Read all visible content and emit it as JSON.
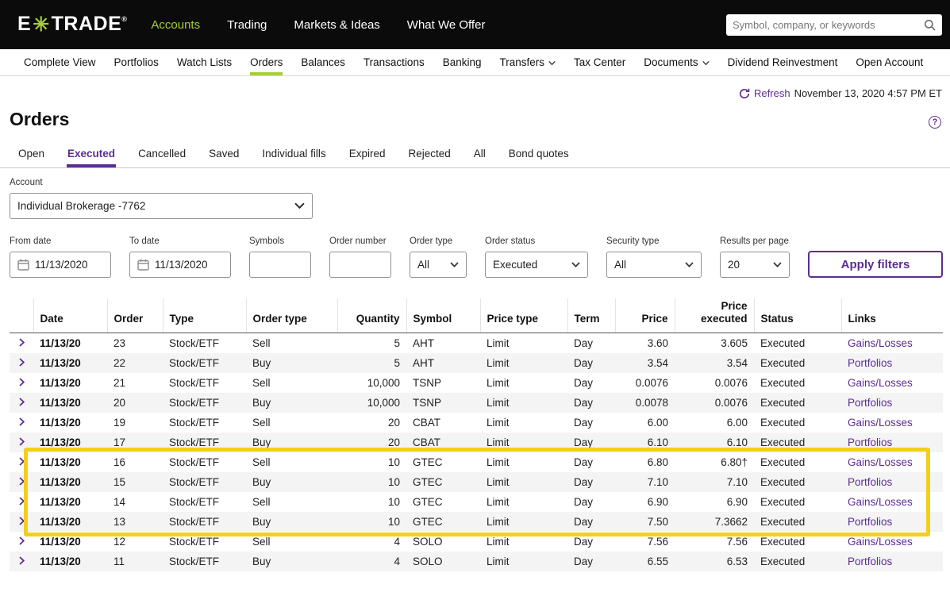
{
  "topnav": {
    "logo": {
      "prefix": "E",
      "star": "✳",
      "suffix": "TRADE",
      "reg": "®"
    },
    "items": [
      {
        "label": "Accounts",
        "active": true
      },
      {
        "label": "Trading",
        "active": false
      },
      {
        "label": "Markets & Ideas",
        "active": false
      },
      {
        "label": "What We Offer",
        "active": false
      }
    ],
    "search": {
      "placeholder": "Symbol, company, or keywords"
    }
  },
  "subnav": {
    "items": [
      {
        "label": "Complete View"
      },
      {
        "label": "Portfolios"
      },
      {
        "label": "Watch Lists"
      },
      {
        "label": "Orders",
        "active": true
      },
      {
        "label": "Balances"
      },
      {
        "label": "Transactions"
      },
      {
        "label": "Banking"
      },
      {
        "label": "Transfers",
        "dropdown": true
      },
      {
        "label": "Tax Center"
      },
      {
        "label": "Documents",
        "dropdown": true
      },
      {
        "label": "Dividend Reinvestment"
      },
      {
        "label": "Open Account"
      }
    ]
  },
  "refresh": {
    "label": "Refresh",
    "timestamp": "November 13, 2020 4:57 PM ET"
  },
  "icons": {
    "help": "?",
    "search": "search-icon",
    "refresh": "refresh-icon",
    "calendar": "calendar-icon",
    "chevron_down": "chevron-down-icon",
    "expand_row": "chevron-right-icon"
  },
  "page_title": "Orders",
  "tabs": [
    {
      "label": "Open"
    },
    {
      "label": "Executed",
      "active": true
    },
    {
      "label": "Cancelled"
    },
    {
      "label": "Saved"
    },
    {
      "label": "Individual fills"
    },
    {
      "label": "Expired"
    },
    {
      "label": "Rejected"
    },
    {
      "label": "All"
    },
    {
      "label": "Bond quotes"
    }
  ],
  "account": {
    "label": "Account",
    "value": "Individual Brokerage -7762"
  },
  "filters": {
    "fields": [
      {
        "label": "From date",
        "type": "date",
        "value": "11/13/2020"
      },
      {
        "label": "To date",
        "type": "date",
        "value": "11/13/2020"
      },
      {
        "label": "Symbols",
        "type": "text",
        "value": ""
      },
      {
        "label": "Order number",
        "type": "text",
        "value": ""
      },
      {
        "label": "Order type",
        "type": "select",
        "value": "All"
      },
      {
        "label": "Order status",
        "type": "select",
        "value": "Executed"
      },
      {
        "label": "Security type",
        "type": "select",
        "value": "All"
      },
      {
        "label": "Results per page",
        "type": "select",
        "value": "20"
      }
    ],
    "apply_label": "Apply filters"
  },
  "table": {
    "columns": [
      {
        "label": "",
        "align": "left"
      },
      {
        "label": "Date",
        "align": "left"
      },
      {
        "label": "Order",
        "align": "left"
      },
      {
        "label": "Type",
        "align": "left"
      },
      {
        "label": "Order type",
        "align": "left"
      },
      {
        "label": "Quantity",
        "align": "right"
      },
      {
        "label": "Symbol",
        "align": "left"
      },
      {
        "label": "Price type",
        "align": "left"
      },
      {
        "label": "Term",
        "align": "left"
      },
      {
        "label": "Price",
        "align": "right"
      },
      {
        "label": "Price\nexecuted",
        "align": "right"
      },
      {
        "label": "Status",
        "align": "left"
      },
      {
        "label": "Links",
        "align": "left"
      }
    ],
    "rows": [
      {
        "date": "11/13/20",
        "order": "23",
        "type": "Stock/ETF",
        "order_type": "Sell",
        "quantity": "5",
        "symbol": "AHT",
        "price_type": "Limit",
        "term": "Day",
        "price": "3.60",
        "price_executed": "3.605",
        "status": "Executed",
        "link": "Gains/Losses",
        "highlighted": false
      },
      {
        "date": "11/13/20",
        "order": "22",
        "type": "Stock/ETF",
        "order_type": "Buy",
        "quantity": "5",
        "symbol": "AHT",
        "price_type": "Limit",
        "term": "Day",
        "price": "3.54",
        "price_executed": "3.54",
        "status": "Executed",
        "link": "Portfolios",
        "highlighted": false
      },
      {
        "date": "11/13/20",
        "order": "21",
        "type": "Stock/ETF",
        "order_type": "Sell",
        "quantity": "10,000",
        "symbol": "TSNP",
        "price_type": "Limit",
        "term": "Day",
        "price": "0.0076",
        "price_executed": "0.0076",
        "status": "Executed",
        "link": "Gains/Losses",
        "highlighted": false
      },
      {
        "date": "11/13/20",
        "order": "20",
        "type": "Stock/ETF",
        "order_type": "Buy",
        "quantity": "10,000",
        "symbol": "TSNP",
        "price_type": "Limit",
        "term": "Day",
        "price": "0.0078",
        "price_executed": "0.0076",
        "status": "Executed",
        "link": "Portfolios",
        "highlighted": false
      },
      {
        "date": "11/13/20",
        "order": "19",
        "type": "Stock/ETF",
        "order_type": "Sell",
        "quantity": "20",
        "symbol": "CBAT",
        "price_type": "Limit",
        "term": "Day",
        "price": "6.00",
        "price_executed": "6.00",
        "status": "Executed",
        "link": "Gains/Losses",
        "highlighted": false
      },
      {
        "date": "11/13/20",
        "order": "17",
        "type": "Stock/ETF",
        "order_type": "Buy",
        "quantity": "20",
        "symbol": "CBAT",
        "price_type": "Limit",
        "term": "Day",
        "price": "6.10",
        "price_executed": "6.10",
        "status": "Executed",
        "link": "Portfolios",
        "highlighted": false
      },
      {
        "date": "11/13/20",
        "order": "16",
        "type": "Stock/ETF",
        "order_type": "Sell",
        "quantity": "10",
        "symbol": "GTEC",
        "price_type": "Limit",
        "term": "Day",
        "price": "6.80",
        "price_executed": "6.80†",
        "status": "Executed",
        "link": "Gains/Losses",
        "highlighted": true
      },
      {
        "date": "11/13/20",
        "order": "15",
        "type": "Stock/ETF",
        "order_type": "Buy",
        "quantity": "10",
        "symbol": "GTEC",
        "price_type": "Limit",
        "term": "Day",
        "price": "7.10",
        "price_executed": "7.10",
        "status": "Executed",
        "link": "Portfolios",
        "highlighted": true
      },
      {
        "date": "11/13/20",
        "order": "14",
        "type": "Stock/ETF",
        "order_type": "Sell",
        "quantity": "10",
        "symbol": "GTEC",
        "price_type": "Limit",
        "term": "Day",
        "price": "6.90",
        "price_executed": "6.90",
        "status": "Executed",
        "link": "Gains/Losses",
        "highlighted": true
      },
      {
        "date": "11/13/20",
        "order": "13",
        "type": "Stock/ETF",
        "order_type": "Buy",
        "quantity": "10",
        "symbol": "GTEC",
        "price_type": "Limit",
        "term": "Day",
        "price": "7.50",
        "price_executed": "7.3662",
        "status": "Executed",
        "link": "Portfolios",
        "highlighted": true
      },
      {
        "date": "11/13/20",
        "order": "12",
        "type": "Stock/ETF",
        "order_type": "Sell",
        "quantity": "4",
        "symbol": "SOLO",
        "price_type": "Limit",
        "term": "Day",
        "price": "7.56",
        "price_executed": "7.56",
        "status": "Executed",
        "link": "Gains/Losses",
        "highlighted": false
      },
      {
        "date": "11/13/20",
        "order": "11",
        "type": "Stock/ETF",
        "order_type": "Buy",
        "quantity": "4",
        "symbol": "SOLO",
        "price_type": "Limit",
        "term": "Day",
        "price": "6.55",
        "price_executed": "6.53",
        "status": "Executed",
        "link": "Portfolios",
        "highlighted": false
      }
    ]
  },
  "annotation": {
    "type": "highlight-box",
    "color": "#f2cf1d",
    "highlighted_orders": [
      "16",
      "15",
      "14",
      "13"
    ]
  },
  "colors": {
    "accent_purple": "#5c2d91",
    "brand_green": "#a7ce38",
    "topnav_black": "#0b0b0b",
    "row_stripe": "#f4f4f4",
    "highlight_yellow": "#f2cf1d"
  }
}
